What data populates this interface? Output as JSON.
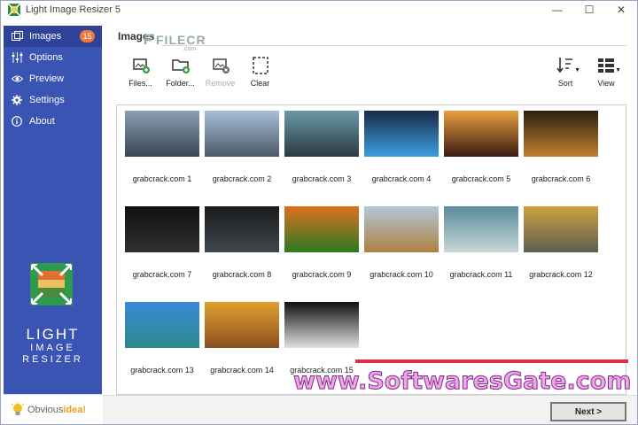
{
  "window": {
    "title": "Light Image Resizer 5"
  },
  "controls": {
    "minimize": "—",
    "maximize": "☐",
    "close": "✕"
  },
  "sidebar": {
    "items": [
      {
        "label": "Images",
        "badge": "15",
        "icon": "images-icon"
      },
      {
        "label": "Options",
        "icon": "sliders-icon"
      },
      {
        "label": "Preview",
        "icon": "eye-icon"
      },
      {
        "label": "Settings",
        "icon": "gear-icon"
      },
      {
        "label": "About",
        "icon": "info-icon"
      }
    ],
    "logo": {
      "line1": "LIGHT",
      "line2": "IMAGE",
      "line3": "RESIZER"
    },
    "footer": {
      "brand_a": "Obvious",
      "brand_b": "idea!"
    }
  },
  "main": {
    "title": "Images",
    "watermark_top": "FILECR",
    "watermark_top_sub": ".com",
    "toolbar": {
      "files": "Files...",
      "folder": "Folder...",
      "remove": "Remove",
      "clear": "Clear",
      "sort": "Sort",
      "view": "View"
    },
    "images": [
      {
        "caption": "grabcrack.com 1",
        "colors": [
          "#8aa0b8",
          "#3a4450"
        ]
      },
      {
        "caption": "grabcrack.com 2",
        "colors": [
          "#a8c0d8",
          "#4a5868"
        ]
      },
      {
        "caption": "grabcrack.com 3",
        "colors": [
          "#6a98a8",
          "#2a3a40"
        ]
      },
      {
        "caption": "grabcrack.com 4",
        "colors": [
          "#1a2a48",
          "#3aa0e0"
        ]
      },
      {
        "caption": "grabcrack.com 5",
        "colors": [
          "#e8a040",
          "#3a1a10"
        ]
      },
      {
        "caption": "grabcrack.com 6",
        "colors": [
          "#2a2010",
          "#c08030"
        ]
      },
      {
        "caption": "grabcrack.com 7",
        "colors": [
          "#101010",
          "#303030"
        ]
      },
      {
        "caption": "grabcrack.com 8",
        "colors": [
          "#1a1a1a",
          "#404850"
        ]
      },
      {
        "caption": "grabcrack.com 9",
        "colors": [
          "#e07020",
          "#2a7a20"
        ]
      },
      {
        "caption": "grabcrack.com 10",
        "colors": [
          "#b0c8d8",
          "#b08040"
        ]
      },
      {
        "caption": "grabcrack.com 11",
        "colors": [
          "#5a8a9a",
          "#c8d8d8"
        ]
      },
      {
        "caption": "grabcrack.com 12",
        "colors": [
          "#d0a040",
          "#5a6050"
        ]
      },
      {
        "caption": "grabcrack.com 13",
        "colors": [
          "#3a8ad8",
          "#2a8a8a"
        ]
      },
      {
        "caption": "grabcrack.com 14",
        "colors": [
          "#e0a030",
          "#8a5020"
        ]
      },
      {
        "caption": "grabcrack.com 15",
        "colors": [
          "#101010",
          "#e0e0e0"
        ]
      }
    ],
    "next": "Next >",
    "watermark_bottom": "www.SoftwaresGate.com"
  }
}
